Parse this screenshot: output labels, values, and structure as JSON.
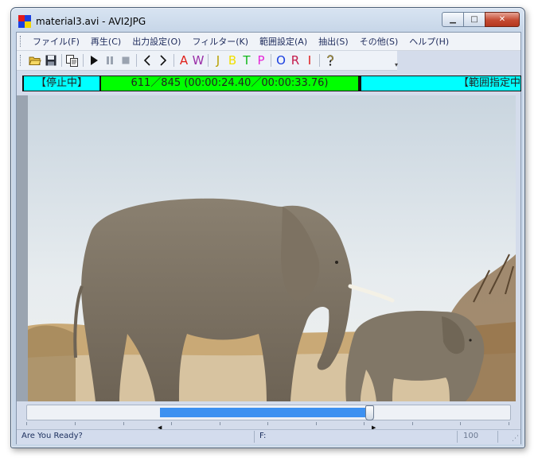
{
  "window": {
    "title": "material3.avi - AVI2JPG",
    "controls": {
      "minimize_icon": "minimize-icon",
      "maximize_icon": "maximize-icon",
      "close_icon": "close-icon"
    }
  },
  "menu": {
    "items": [
      "ファイル(F)",
      "再生(C)",
      "出力設定(O)",
      "フィルター(K)",
      "範囲設定(A)",
      "抽出(S)",
      "その他(S)",
      "ヘルプ(H)"
    ]
  },
  "toolbar": {
    "icons": [
      "open-folder-icon",
      "save-icon",
      "copy-icon",
      "play-icon",
      "pause-icon",
      "stop-icon",
      "prev-icon",
      "next-icon"
    ],
    "letters": [
      {
        "text": "A",
        "color": "#e0201a"
      },
      {
        "text": "W",
        "color": "#9a2fa8"
      },
      {
        "text": "J",
        "color": "#b8a000"
      },
      {
        "text": "B",
        "color": "#f0e000"
      },
      {
        "text": "T",
        "color": "#11b81a"
      },
      {
        "text": "P",
        "color": "#e526d8"
      },
      {
        "text": "O",
        "color": "#1a3fe0"
      },
      {
        "text": "R",
        "color": "#c41a4a"
      },
      {
        "text": "I",
        "color": "#e01a1a"
      }
    ],
    "help_icon": "help-icon"
  },
  "status": {
    "state": "【停止中】",
    "frame": "611／845 (00:00:24.40／00:00:33.76)",
    "range": "【範囲指定中",
    "colors": {
      "state": "#00ffff",
      "frame": "#00ff00",
      "range": "#00ffff"
    }
  },
  "seek": {
    "position": 0.7,
    "range_start": 0.275,
    "range_end": 0.714
  },
  "statusbar": {
    "message": "Are You Ready?",
    "field": "F:",
    "zoom": "100"
  }
}
